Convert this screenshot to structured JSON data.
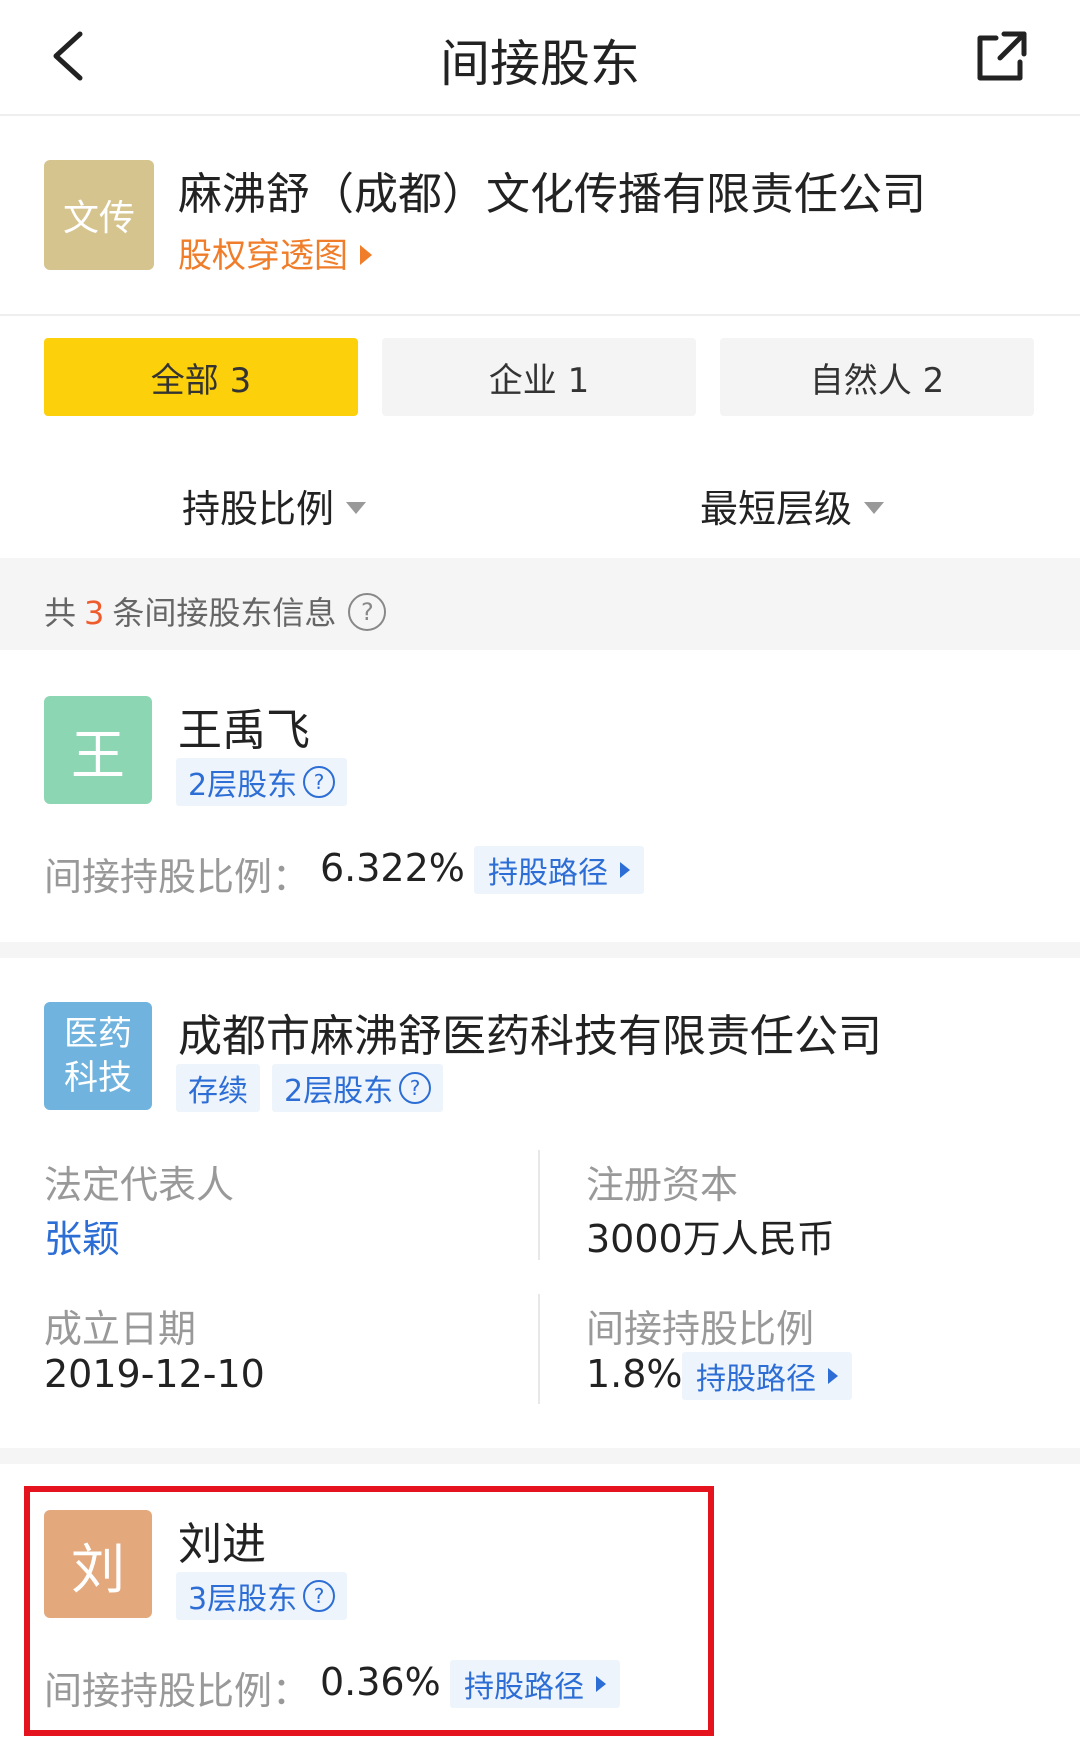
{
  "nav": {
    "title": "间接股东"
  },
  "company": {
    "logo_text": "文传",
    "name": "麻沸舒（成都）文化传播有限责任公司",
    "equity_link": "股权穿透图"
  },
  "tabs": [
    {
      "label": "全部 3",
      "active": true
    },
    {
      "label": "企业 1",
      "active": false
    },
    {
      "label": "自然人 2",
      "active": false
    }
  ],
  "sort": {
    "ratio_label": "持股比例",
    "level_label": "最短层级"
  },
  "summary": {
    "prefix": "共",
    "count": "3",
    "suffix": "条间接股东信息",
    "help": "?"
  },
  "entries": [
    {
      "avatar_text": "王",
      "avatar_color": "#8dd6b3",
      "name": "王禹飞",
      "level_badge": "2层股东",
      "ratio_label": "间接持股比例：",
      "ratio_value": "6.322%",
      "path_label": "持股路径"
    },
    {
      "avatar_text": "医药科技",
      "avatar_color": "#6fb3de",
      "name": "成都市麻沸舒医药科技有限责任公司",
      "status_badge": "存续",
      "level_badge": "2层股东",
      "legal_rep_label": "法定代表人",
      "legal_rep_value": "张颖",
      "capital_label": "注册资本",
      "capital_value": "3000万人民币",
      "founded_label": "成立日期",
      "founded_value": "2019-12-10",
      "ratio_label": "间接持股比例",
      "ratio_value": "1.8%",
      "path_label": "持股路径"
    },
    {
      "avatar_text": "刘",
      "avatar_color": "#e3a87c",
      "name": "刘进",
      "level_badge": "3层股东",
      "ratio_label": "间接持股比例：",
      "ratio_value": "0.36%",
      "path_label": "持股路径"
    }
  ],
  "colors": {
    "accent_yellow": "#fcd00a",
    "link_orange": "#ef7d2a",
    "link_blue": "#2c6ed5",
    "highlight_red": "#e5131d"
  }
}
